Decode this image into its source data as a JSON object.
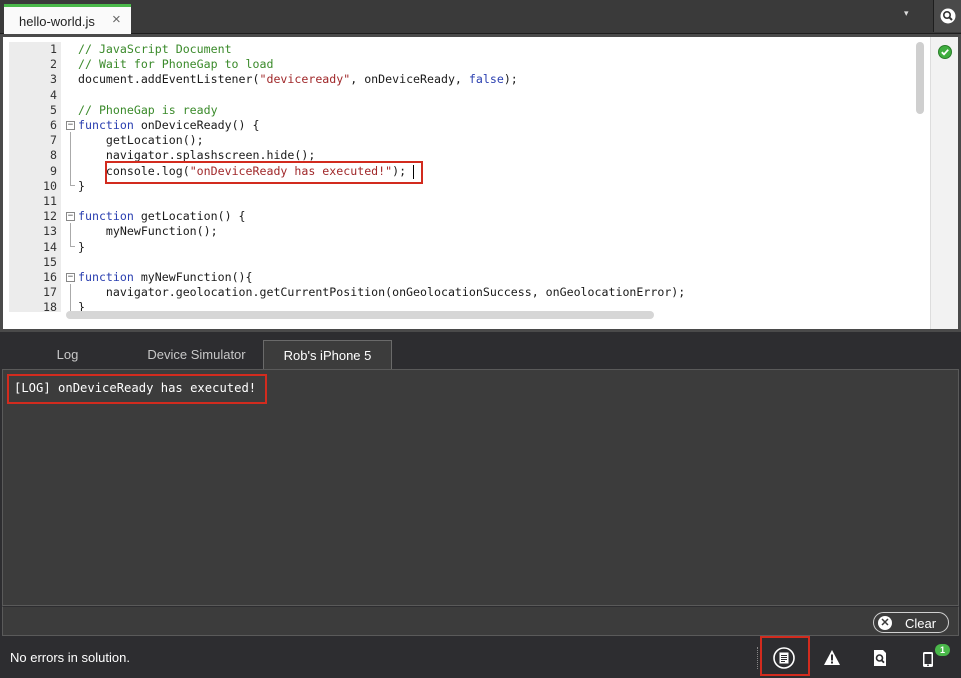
{
  "file_tab": {
    "label": "hello-world.js",
    "close_glyph": "×"
  },
  "tab_overflow_glyph": "▾",
  "editor": {
    "lines": [
      {
        "n": "1",
        "parts": [
          {
            "c": "cm",
            "t": "// JavaScript Document"
          }
        ]
      },
      {
        "n": "2",
        "parts": [
          {
            "c": "cm",
            "t": "// Wait for PhoneGap to load"
          }
        ]
      },
      {
        "n": "3",
        "parts": [
          {
            "c": "",
            "t": "document.addEventListener("
          },
          {
            "c": "st",
            "t": "\"deviceready\""
          },
          {
            "c": "",
            "t": ", onDeviceReady, "
          },
          {
            "c": "kw",
            "t": "false"
          },
          {
            "c": "",
            "t": ");"
          }
        ]
      },
      {
        "n": "4",
        "parts": []
      },
      {
        "n": "5",
        "parts": [
          {
            "c": "cm",
            "t": "// PhoneGap is ready"
          }
        ]
      },
      {
        "n": "6",
        "parts": [
          {
            "c": "kw",
            "t": "function"
          },
          {
            "c": "",
            "t": " onDeviceReady() {"
          }
        ]
      },
      {
        "n": "7",
        "parts": [
          {
            "c": "",
            "t": "    getLocation();"
          }
        ]
      },
      {
        "n": "8",
        "parts": [
          {
            "c": "",
            "t": "    navigator.splashscreen.hide();"
          }
        ]
      },
      {
        "n": "9",
        "parts": [
          {
            "c": "",
            "t": "    console.log("
          },
          {
            "c": "st",
            "t": "\"onDeviceReady has executed!\""
          },
          {
            "c": "",
            "t": ");"
          }
        ]
      },
      {
        "n": "10",
        "parts": [
          {
            "c": "",
            "t": "}"
          }
        ]
      },
      {
        "n": "11",
        "parts": []
      },
      {
        "n": "12",
        "parts": [
          {
            "c": "kw",
            "t": "function"
          },
          {
            "c": "",
            "t": " getLocation() {"
          }
        ]
      },
      {
        "n": "13",
        "parts": [
          {
            "c": "",
            "t": "    myNewFunction();"
          }
        ]
      },
      {
        "n": "14",
        "parts": [
          {
            "c": "",
            "t": "}"
          }
        ]
      },
      {
        "n": "15",
        "parts": []
      },
      {
        "n": "16",
        "parts": [
          {
            "c": "kw",
            "t": "function"
          },
          {
            "c": "",
            "t": " myNewFunction(){"
          }
        ]
      },
      {
        "n": "17",
        "parts": [
          {
            "c": "",
            "t": "    navigator.geolocation.getCurrentPosition(onGeolocationSuccess, onGeolocationError);"
          }
        ]
      },
      {
        "n": "18",
        "parts": [
          {
            "c": "",
            "t": "}"
          }
        ]
      }
    ],
    "fold_lines": [
      6,
      12,
      16
    ],
    "highlighted_line": 9
  },
  "panel": {
    "tabs": [
      {
        "label": "Log",
        "active": false
      },
      {
        "label": "Device Simulator",
        "active": false
      },
      {
        "label": "Rob's iPhone 5",
        "active": true
      }
    ],
    "log_lines": [
      "[LOG] onDeviceReady has executed!"
    ],
    "clear_label": "Clear"
  },
  "statusbar": {
    "text": "No errors in solution.",
    "icons": [
      "output-log-icon",
      "warning-icon",
      "find-results-icon",
      "device-icon"
    ],
    "device_badge_count": "1"
  },
  "colors": {
    "accent_green": "#4ab84a",
    "highlight_red": "#d22b1e"
  }
}
